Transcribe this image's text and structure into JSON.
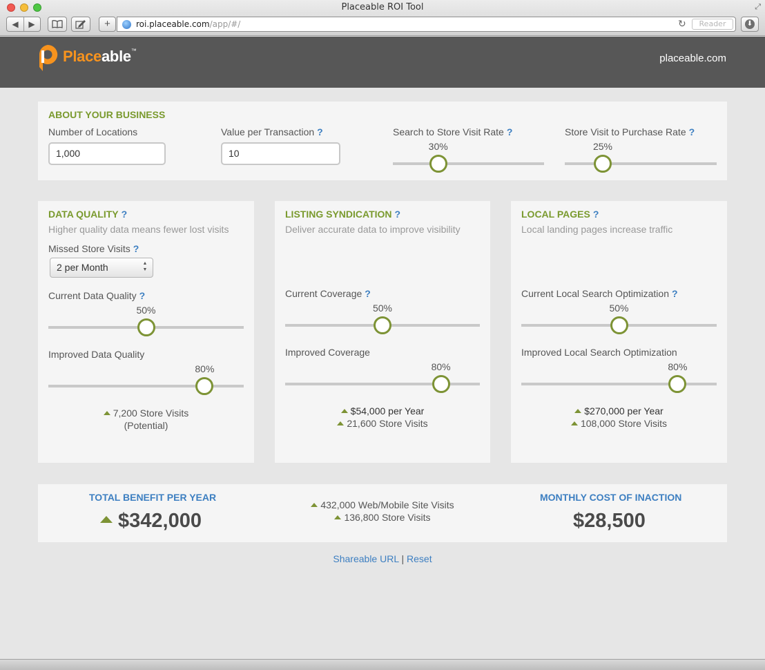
{
  "window": {
    "title": "Placeable ROI Tool",
    "nav_back": "◀",
    "nav_forward": "▶",
    "add_label": "+",
    "url_host": "roi.placeable.com",
    "url_path": "/app/#/",
    "reload": "↻",
    "reader_label": "Reader"
  },
  "header": {
    "brand_a": "Place",
    "brand_b": "able",
    "brand_tm": "™",
    "site_link": "placeable.com"
  },
  "about": {
    "heading": "ABOUT YOUR BUSINESS",
    "locations_label": "Number of Locations",
    "locations_value": "1,000",
    "value_label": "Value per Transaction",
    "value_value": "10",
    "visit_rate_label": "Search to Store Visit Rate",
    "visit_rate_pct": "30%",
    "visit_rate_value": 0.3,
    "purchase_rate_label": "Store Visit to Purchase Rate",
    "purchase_rate_pct": "25%",
    "purchase_rate_value": 0.25
  },
  "help_mark": "?",
  "data_quality": {
    "heading": "DATA QUALITY",
    "subtitle": "Higher quality data means fewer lost visits",
    "missed_label": "Missed Store Visits",
    "missed_value": "2 per Month",
    "current_label": "Current Data Quality",
    "current_pct": "50%",
    "current_value": 0.5,
    "improved_label": "Improved Data Quality",
    "improved_pct": "80%",
    "improved_value": 0.8,
    "result_line1": "7,200 Store Visits",
    "result_line2": "(Potential)"
  },
  "listing": {
    "heading": "LISTING SYNDICATION",
    "subtitle": "Deliver accurate data to improve visibility",
    "current_label": "Current Coverage",
    "current_pct": "50%",
    "current_value": 0.5,
    "improved_label": "Improved Coverage",
    "improved_pct": "80%",
    "improved_value": 0.8,
    "result_money": "$54,000 per Year",
    "result_visits": "21,600 Store Visits"
  },
  "local_pages": {
    "heading": "LOCAL PAGES",
    "subtitle": "Local landing pages increase traffic",
    "current_label": "Current Local Search Optimization",
    "current_pct": "50%",
    "current_value": 0.5,
    "improved_label": "Improved Local Search Optimization",
    "improved_pct": "80%",
    "improved_value": 0.8,
    "result_money": "$270,000 per Year",
    "result_visits": "108,000 Store Visits"
  },
  "summary": {
    "total_heading": "TOTAL BENEFIT PER YEAR",
    "total_value": "$342,000",
    "web_visits": "432,000 Web/Mobile Site Visits",
    "store_visits": "136,800 Store Visits",
    "inaction_heading": "MONTHLY COST OF INACTION",
    "inaction_value": "$28,500"
  },
  "footer": {
    "share_label": "Shareable URL",
    "separator": "|",
    "reset_label": "Reset"
  },
  "colors": {
    "accent_green": "#7a9a2e",
    "link_blue": "#3d7fc1",
    "brand_orange": "#f7931e",
    "header_gray": "#575757"
  }
}
